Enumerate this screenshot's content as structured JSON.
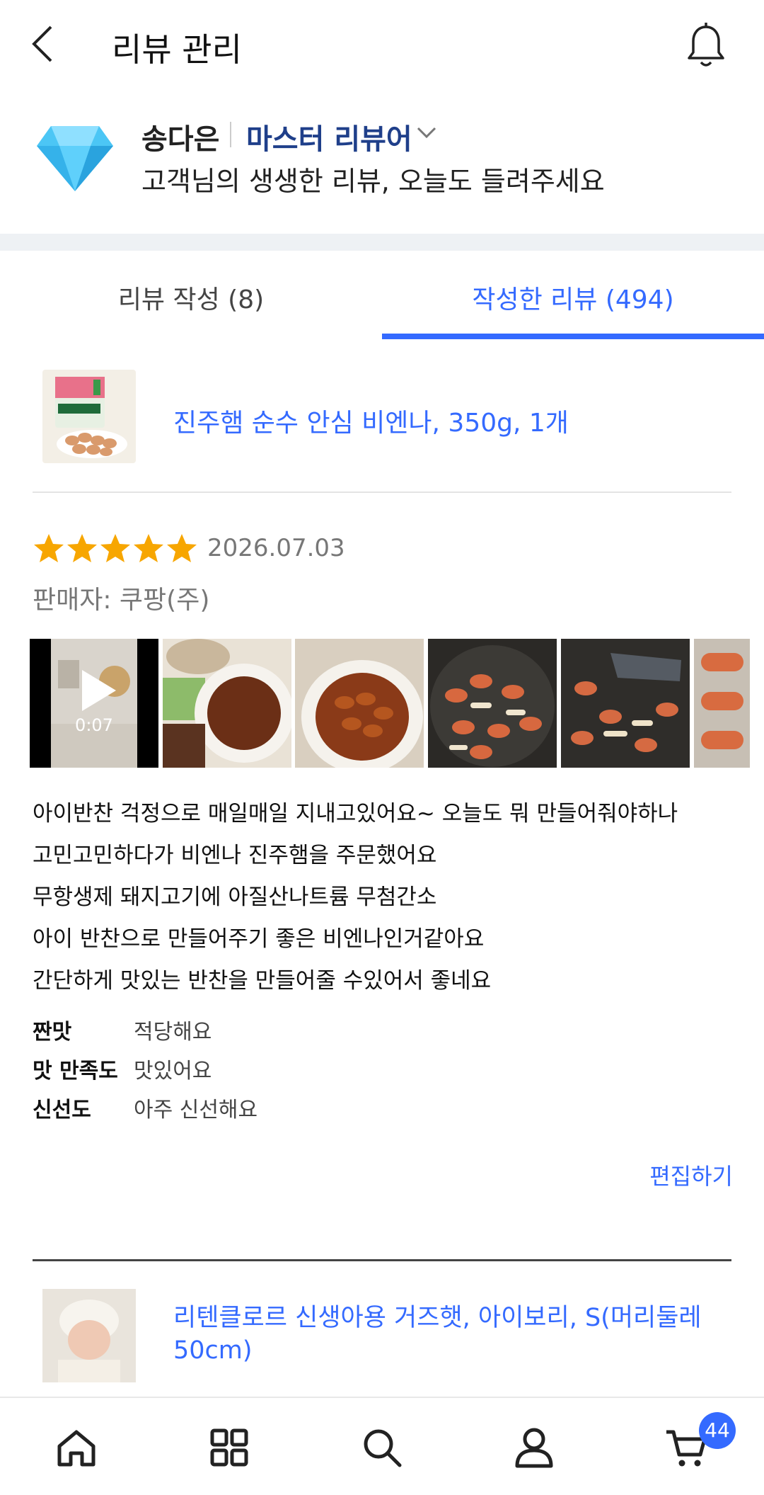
{
  "header": {
    "title": "리뷰 관리",
    "back_icon": "chevron-left-icon",
    "bell_icon": "bell-icon"
  },
  "profile": {
    "name": "송다은",
    "level": "마스터 리뷰어",
    "subtitle": "고객님의 생생한 리뷰, 오늘도 들려주세요",
    "gem_color": "#4cc6f5"
  },
  "tabs": [
    {
      "label": "리뷰 작성 (8)",
      "active": false
    },
    {
      "label": "작성한 리뷰 (494)",
      "active": true
    }
  ],
  "review": {
    "product_title": "진주햄 순수 안심 비엔나, 350g, 1개",
    "rating": 5,
    "date": "2026.07.03",
    "seller": "판매자: 쿠팡(주)",
    "video_duration": "0:07",
    "lines": [
      "아이반찬 걱정으로 매일매일 지내고있어요~ 오늘도 뭐 만들어줘야하나",
      "고민고민하다가 비엔나 진주햄을  주문했어요",
      "무항생제 돼지고기에 아질산나트륨 무첨간소",
      "아이 반찬으로 만들어주기 좋은 비엔나인거같아요",
      "간단하게 맛있는 반찬을 만들어줄 수있어서 좋네요"
    ],
    "attributes": [
      {
        "key": "짠맛",
        "value": "적당해요"
      },
      {
        "key": "맛 만족도",
        "value": "맛있어요"
      },
      {
        "key": "신선도",
        "value": "아주 신선해요"
      }
    ],
    "edit_label": "편집하기"
  },
  "next_product": {
    "title": "리텐클로르 신생아용 거즈햇, 아이보리, S(머리둘레 50cm)"
  },
  "bottom_nav": {
    "items": [
      "home-icon",
      "grid-icon",
      "search-icon",
      "person-icon",
      "cart-icon"
    ],
    "cart_badge": "44"
  },
  "colors": {
    "accent": "#346aff",
    "level": "#1f3f8a",
    "star": "#f7a600"
  }
}
